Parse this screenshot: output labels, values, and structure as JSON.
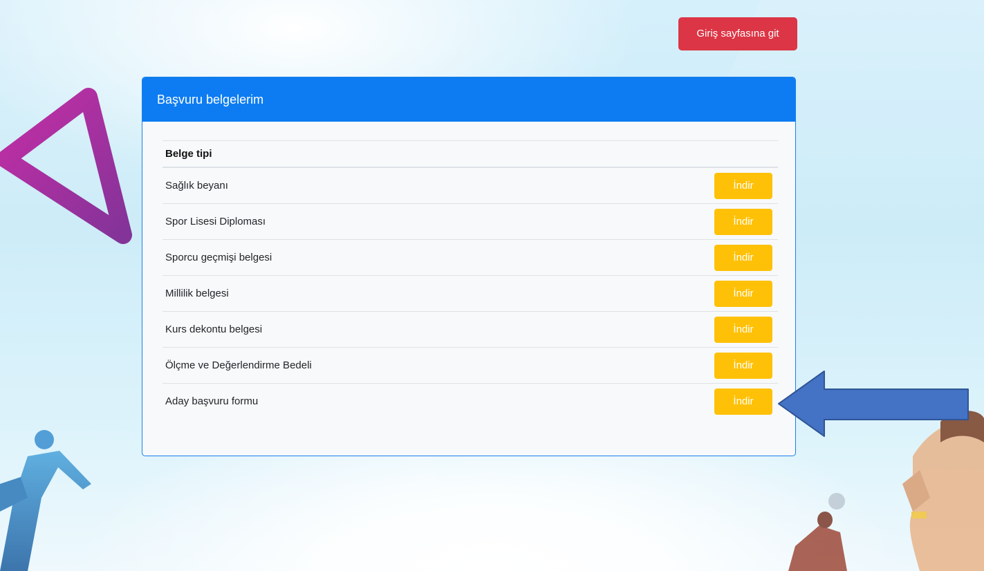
{
  "header": {
    "login_button": "Giriş sayfasına git"
  },
  "card": {
    "title": "Başvuru belgelerim",
    "column_header": "Belge tipi",
    "rows": [
      {
        "label": "Sağlık beyanı",
        "button": "İndir"
      },
      {
        "label": "Spor Lisesi Diploması",
        "button": "İndir"
      },
      {
        "label": "Sporcu geçmişi belgesi",
        "button": "İndir"
      },
      {
        "label": "Millilik belgesi",
        "button": "İndir"
      },
      {
        "label": "Kurs dekontu belgesi",
        "button": "İndir"
      },
      {
        "label": "Ölçme ve Değerlendirme Bedeli",
        "button": "İndir"
      },
      {
        "label": "Aday başvuru formu",
        "button": "İndir"
      }
    ]
  },
  "colors": {
    "primary": "#0d7cf2",
    "danger": "#dc3545",
    "warning": "#ffc107",
    "arrow": "#4472c4"
  },
  "icons": {
    "decoration_left": "triangle-decoration-icon",
    "pointer": "left-arrow-icon"
  }
}
